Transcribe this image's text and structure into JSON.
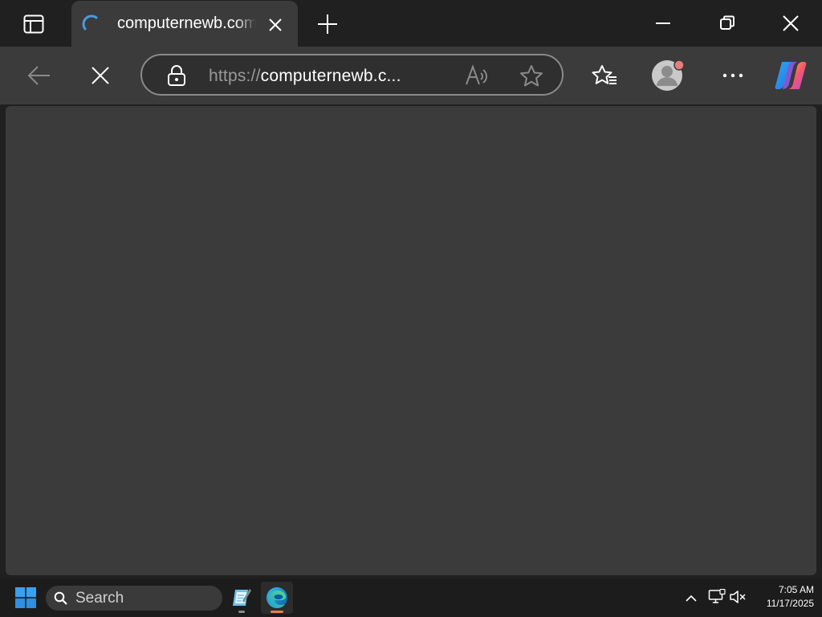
{
  "tab": {
    "title": "computernewb.com",
    "spinner_color": "#4a9be0"
  },
  "toolbar": {
    "url_scheme": "https://",
    "url_host": "computernewb.c...",
    "profile_badge_color": "#e97c7c"
  },
  "taskbar": {
    "search_label": "Search",
    "time": "7:05 AM",
    "date": "11/17/2025",
    "edge_active_color": "#f07a4f"
  },
  "icons": {
    "tab_actions": "tab-actions-icon",
    "loading": "loading-spinner-icon",
    "close_tab": "close-icon",
    "new_tab": "plus-icon",
    "minimize": "minimize-icon",
    "restore": "restore-icon",
    "close_window": "close-icon",
    "back": "back-arrow-icon",
    "stop": "stop-icon",
    "lock": "lock-icon",
    "read_aloud": "read-aloud-icon",
    "favorite": "star-icon",
    "favorites": "favorites-icon",
    "profile": "profile-icon",
    "more": "more-icon",
    "copilot": "copilot-icon",
    "start": "windows-start-icon",
    "search": "search-icon",
    "notepad": "notepad-app-icon",
    "edge": "edge-browser-icon",
    "tray_chevron": "chevron-up-icon",
    "network": "network-icon",
    "volume": "volume-muted-icon"
  }
}
